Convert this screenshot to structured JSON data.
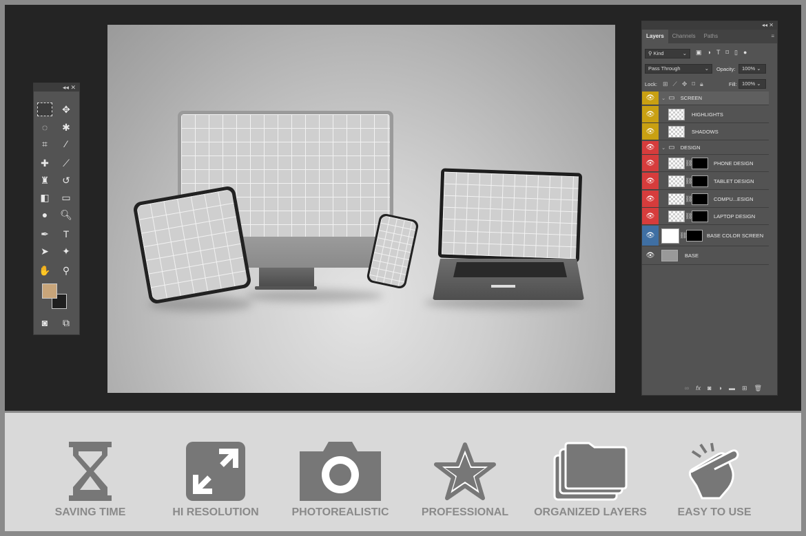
{
  "toolbar": {
    "collapse": "◂◂",
    "close": "✕"
  },
  "colors": {
    "foreground": "#c8a57a",
    "background": "#1f1f1f",
    "screen_group": "#c9a012",
    "design_group": "#d63c3c",
    "base_color": "#3f6fa3"
  },
  "layers_panel": {
    "header_controls": "◂◂ ✕",
    "tabs": [
      {
        "label": "Layers",
        "active": true
      },
      {
        "label": "Channels",
        "active": false
      },
      {
        "label": "Paths",
        "active": false
      }
    ],
    "filter": "Kind",
    "blend_mode": "Pass Through",
    "opacity_label": "Opacity:",
    "opacity": "100%",
    "lock_label": "Lock:",
    "fill_label": "Fill:",
    "fill": "100%",
    "layers": [
      {
        "name": "SCREEN",
        "type": "group",
        "color": "#c9a012"
      },
      {
        "name": "HIGHLIGHTS",
        "type": "layer",
        "color": "#c9a012"
      },
      {
        "name": "SHADOWS",
        "type": "layer",
        "color": "#c9a012"
      },
      {
        "name": "DESIGN",
        "type": "group",
        "color": "#d63c3c"
      },
      {
        "name": "PHONE DESIGN",
        "type": "smart",
        "color": "#d63c3c"
      },
      {
        "name": "TABLET DESIGN",
        "type": "smart",
        "color": "#d63c3c"
      },
      {
        "name": "COMPU...ESIGN",
        "type": "smart",
        "color": "#d63c3c"
      },
      {
        "name": "LAPTOP DESIGN",
        "type": "smart",
        "color": "#d63c3c"
      },
      {
        "name": "BASE COLOR SCREEN",
        "type": "fill",
        "color": "#3f6fa3"
      },
      {
        "name": "BASE",
        "type": "layer",
        "color": "#535353"
      }
    ]
  },
  "features": [
    {
      "label": "SAVING TIME",
      "icon": "hourglass-icon"
    },
    {
      "label": "HI RESOLUTION",
      "icon": "expand-arrows-icon"
    },
    {
      "label": "PHOTOREALISTIC",
      "icon": "camera-icon"
    },
    {
      "label": "PROFESSIONAL",
      "icon": "star-icon"
    },
    {
      "label": "ORGANIZED LAYERS",
      "icon": "folders-icon"
    },
    {
      "label": "EASY TO USE",
      "icon": "pointing-hand-icon"
    }
  ]
}
